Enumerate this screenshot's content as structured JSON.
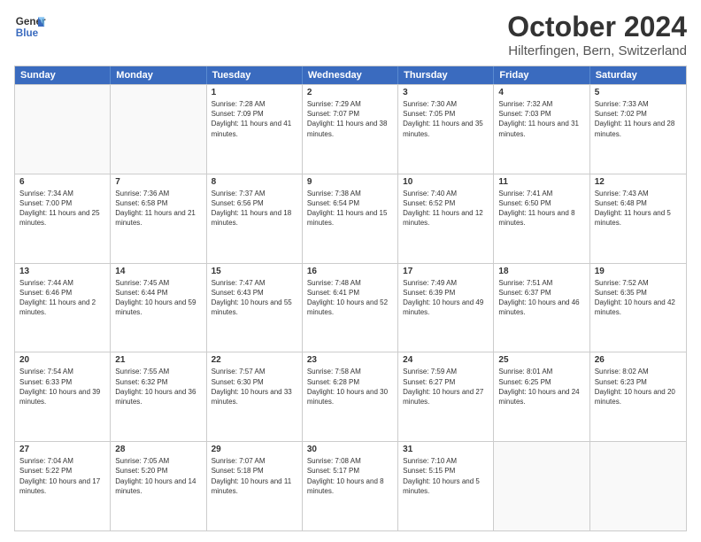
{
  "header": {
    "logo_line1": "General",
    "logo_line2": "Blue",
    "month": "October 2024",
    "location": "Hilterfingen, Bern, Switzerland"
  },
  "weekdays": [
    "Sunday",
    "Monday",
    "Tuesday",
    "Wednesday",
    "Thursday",
    "Friday",
    "Saturday"
  ],
  "weeks": [
    [
      {
        "day": "",
        "sunrise": "",
        "sunset": "",
        "daylight": ""
      },
      {
        "day": "",
        "sunrise": "",
        "sunset": "",
        "daylight": ""
      },
      {
        "day": "1",
        "sunrise": "Sunrise: 7:28 AM",
        "sunset": "Sunset: 7:09 PM",
        "daylight": "Daylight: 11 hours and 41 minutes."
      },
      {
        "day": "2",
        "sunrise": "Sunrise: 7:29 AM",
        "sunset": "Sunset: 7:07 PM",
        "daylight": "Daylight: 11 hours and 38 minutes."
      },
      {
        "day": "3",
        "sunrise": "Sunrise: 7:30 AM",
        "sunset": "Sunset: 7:05 PM",
        "daylight": "Daylight: 11 hours and 35 minutes."
      },
      {
        "day": "4",
        "sunrise": "Sunrise: 7:32 AM",
        "sunset": "Sunset: 7:03 PM",
        "daylight": "Daylight: 11 hours and 31 minutes."
      },
      {
        "day": "5",
        "sunrise": "Sunrise: 7:33 AM",
        "sunset": "Sunset: 7:02 PM",
        "daylight": "Daylight: 11 hours and 28 minutes."
      }
    ],
    [
      {
        "day": "6",
        "sunrise": "Sunrise: 7:34 AM",
        "sunset": "Sunset: 7:00 PM",
        "daylight": "Daylight: 11 hours and 25 minutes."
      },
      {
        "day": "7",
        "sunrise": "Sunrise: 7:36 AM",
        "sunset": "Sunset: 6:58 PM",
        "daylight": "Daylight: 11 hours and 21 minutes."
      },
      {
        "day": "8",
        "sunrise": "Sunrise: 7:37 AM",
        "sunset": "Sunset: 6:56 PM",
        "daylight": "Daylight: 11 hours and 18 minutes."
      },
      {
        "day": "9",
        "sunrise": "Sunrise: 7:38 AM",
        "sunset": "Sunset: 6:54 PM",
        "daylight": "Daylight: 11 hours and 15 minutes."
      },
      {
        "day": "10",
        "sunrise": "Sunrise: 7:40 AM",
        "sunset": "Sunset: 6:52 PM",
        "daylight": "Daylight: 11 hours and 12 minutes."
      },
      {
        "day": "11",
        "sunrise": "Sunrise: 7:41 AM",
        "sunset": "Sunset: 6:50 PM",
        "daylight": "Daylight: 11 hours and 8 minutes."
      },
      {
        "day": "12",
        "sunrise": "Sunrise: 7:43 AM",
        "sunset": "Sunset: 6:48 PM",
        "daylight": "Daylight: 11 hours and 5 minutes."
      }
    ],
    [
      {
        "day": "13",
        "sunrise": "Sunrise: 7:44 AM",
        "sunset": "Sunset: 6:46 PM",
        "daylight": "Daylight: 11 hours and 2 minutes."
      },
      {
        "day": "14",
        "sunrise": "Sunrise: 7:45 AM",
        "sunset": "Sunset: 6:44 PM",
        "daylight": "Daylight: 10 hours and 59 minutes."
      },
      {
        "day": "15",
        "sunrise": "Sunrise: 7:47 AM",
        "sunset": "Sunset: 6:43 PM",
        "daylight": "Daylight: 10 hours and 55 minutes."
      },
      {
        "day": "16",
        "sunrise": "Sunrise: 7:48 AM",
        "sunset": "Sunset: 6:41 PM",
        "daylight": "Daylight: 10 hours and 52 minutes."
      },
      {
        "day": "17",
        "sunrise": "Sunrise: 7:49 AM",
        "sunset": "Sunset: 6:39 PM",
        "daylight": "Daylight: 10 hours and 49 minutes."
      },
      {
        "day": "18",
        "sunrise": "Sunrise: 7:51 AM",
        "sunset": "Sunset: 6:37 PM",
        "daylight": "Daylight: 10 hours and 46 minutes."
      },
      {
        "day": "19",
        "sunrise": "Sunrise: 7:52 AM",
        "sunset": "Sunset: 6:35 PM",
        "daylight": "Daylight: 10 hours and 42 minutes."
      }
    ],
    [
      {
        "day": "20",
        "sunrise": "Sunrise: 7:54 AM",
        "sunset": "Sunset: 6:33 PM",
        "daylight": "Daylight: 10 hours and 39 minutes."
      },
      {
        "day": "21",
        "sunrise": "Sunrise: 7:55 AM",
        "sunset": "Sunset: 6:32 PM",
        "daylight": "Daylight: 10 hours and 36 minutes."
      },
      {
        "day": "22",
        "sunrise": "Sunrise: 7:57 AM",
        "sunset": "Sunset: 6:30 PM",
        "daylight": "Daylight: 10 hours and 33 minutes."
      },
      {
        "day": "23",
        "sunrise": "Sunrise: 7:58 AM",
        "sunset": "Sunset: 6:28 PM",
        "daylight": "Daylight: 10 hours and 30 minutes."
      },
      {
        "day": "24",
        "sunrise": "Sunrise: 7:59 AM",
        "sunset": "Sunset: 6:27 PM",
        "daylight": "Daylight: 10 hours and 27 minutes."
      },
      {
        "day": "25",
        "sunrise": "Sunrise: 8:01 AM",
        "sunset": "Sunset: 6:25 PM",
        "daylight": "Daylight: 10 hours and 24 minutes."
      },
      {
        "day": "26",
        "sunrise": "Sunrise: 8:02 AM",
        "sunset": "Sunset: 6:23 PM",
        "daylight": "Daylight: 10 hours and 20 minutes."
      }
    ],
    [
      {
        "day": "27",
        "sunrise": "Sunrise: 7:04 AM",
        "sunset": "Sunset: 5:22 PM",
        "daylight": "Daylight: 10 hours and 17 minutes."
      },
      {
        "day": "28",
        "sunrise": "Sunrise: 7:05 AM",
        "sunset": "Sunset: 5:20 PM",
        "daylight": "Daylight: 10 hours and 14 minutes."
      },
      {
        "day": "29",
        "sunrise": "Sunrise: 7:07 AM",
        "sunset": "Sunset: 5:18 PM",
        "daylight": "Daylight: 10 hours and 11 minutes."
      },
      {
        "day": "30",
        "sunrise": "Sunrise: 7:08 AM",
        "sunset": "Sunset: 5:17 PM",
        "daylight": "Daylight: 10 hours and 8 minutes."
      },
      {
        "day": "31",
        "sunrise": "Sunrise: 7:10 AM",
        "sunset": "Sunset: 5:15 PM",
        "daylight": "Daylight: 10 hours and 5 minutes."
      },
      {
        "day": "",
        "sunrise": "",
        "sunset": "",
        "daylight": ""
      },
      {
        "day": "",
        "sunrise": "",
        "sunset": "",
        "daylight": ""
      }
    ]
  ]
}
